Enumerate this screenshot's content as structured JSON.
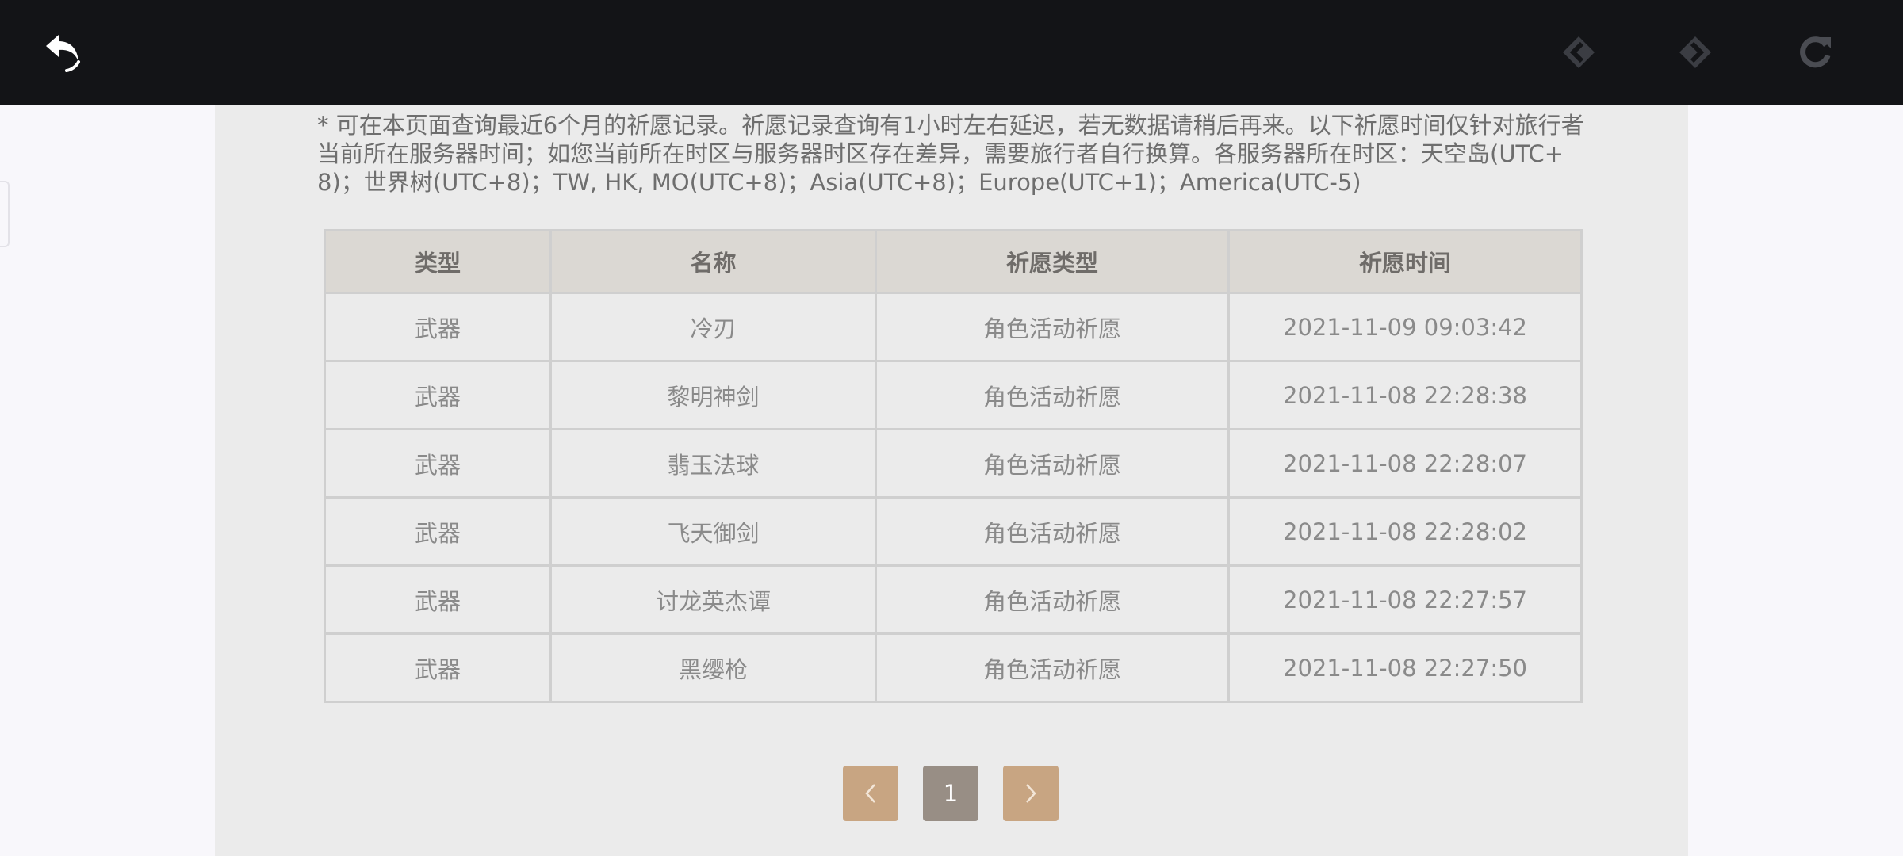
{
  "colors": {
    "toolbar": "#131417",
    "panel": "#ebebeb",
    "header_bg": "#dbd8d3",
    "pager_arrow": "#c8a582",
    "pager_current": "#988e85"
  },
  "toolbar": {
    "back_icon": "undo-arrow-icon",
    "nav_back_icon": "diamond-arrow-left-icon",
    "nav_forward_icon": "diamond-arrow-right-icon",
    "reload_icon": "reload-icon"
  },
  "notice": "* 可在本页面查询最近6个月的祈愿记录。祈愿记录查询有1小时左右延迟，若无数据请稍后再来。以下祈愿时间仅针对旅行者当前所在服务器时间；如您当前所在时区与服务器时区存在差异，需要旅行者自行换算。各服务器所在时区：天空岛(UTC+8)；世界树(UTC+8)；TW, HK, MO(UTC+8)；Asia(UTC+8)；Europe(UTC+1)；America(UTC-5)",
  "table": {
    "headers": [
      "类型",
      "名称",
      "祈愿类型",
      "祈愿时间"
    ],
    "rows": [
      [
        "武器",
        "冷刃",
        "角色活动祈愿",
        "2021-11-09 09:03:42"
      ],
      [
        "武器",
        "黎明神剑",
        "角色活动祈愿",
        "2021-11-08 22:28:38"
      ],
      [
        "武器",
        "翡玉法球",
        "角色活动祈愿",
        "2021-11-08 22:28:07"
      ],
      [
        "武器",
        "飞天御剑",
        "角色活动祈愿",
        "2021-11-08 22:28:02"
      ],
      [
        "武器",
        "讨龙英杰谭",
        "角色活动祈愿",
        "2021-11-08 22:27:57"
      ],
      [
        "武器",
        "黑缨枪",
        "角色活动祈愿",
        "2021-11-08 22:27:50"
      ]
    ]
  },
  "pagination": {
    "prev_icon": "chevron-left-icon",
    "current_page": "1",
    "next_icon": "chevron-right-icon"
  }
}
